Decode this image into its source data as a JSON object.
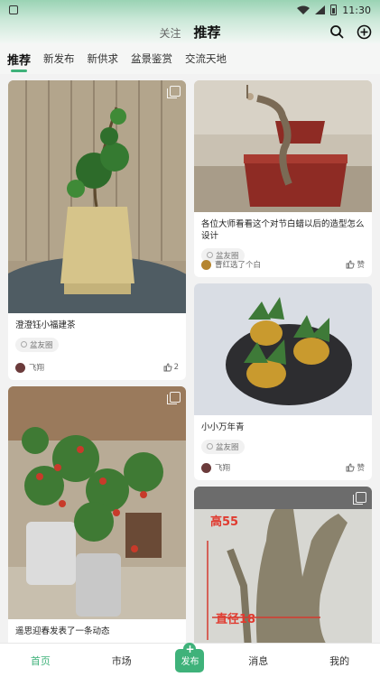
{
  "status_bar": {
    "time": "11:30"
  },
  "header": {
    "tab_follow": "关注",
    "tab_recommend": "推荐",
    "search_icon": "search-icon",
    "add_icon": "add-circle-icon"
  },
  "categories": [
    {
      "label": "推荐",
      "active": true
    },
    {
      "label": "新发布",
      "active": false
    },
    {
      "label": "新供求",
      "active": false
    },
    {
      "label": "盆景鉴赏",
      "active": false
    },
    {
      "label": "交流天地",
      "active": false
    }
  ],
  "posts": [
    {
      "title": "澄澄钰小福建茶",
      "tag": "盆友圈",
      "author": "飞翔",
      "likes": "2",
      "image": "bonsai-fujian-tea"
    },
    {
      "title": "各位大师看看这个对节白蜡以后的造型怎么设计",
      "tag": "盆友圈",
      "author": "曹红选了个白",
      "likes": "赞",
      "image": "bonsai-baila-stump"
    },
    {
      "title": "小小万年青",
      "tag": "盆友圈",
      "author": "飞翔",
      "likes": "赞",
      "image": "gold-pots-plants"
    },
    {
      "title": "遥思迎春发表了一条动态",
      "tag": "",
      "author": "",
      "likes": "",
      "image": "red-berries-pots"
    },
    {
      "title": "",
      "tag": "",
      "author": "",
      "likes": "",
      "image": "trunk-measure",
      "overlay_height": "高55",
      "overlay_diameter": "直径18"
    }
  ],
  "bottom_nav": {
    "home": "首页",
    "market": "市场",
    "publish": "发布",
    "publish_plus": "+",
    "messages": "消息",
    "mine": "我的"
  },
  "colors": {
    "accent": "#3fb27a",
    "header_top": "#9ad3b4"
  }
}
